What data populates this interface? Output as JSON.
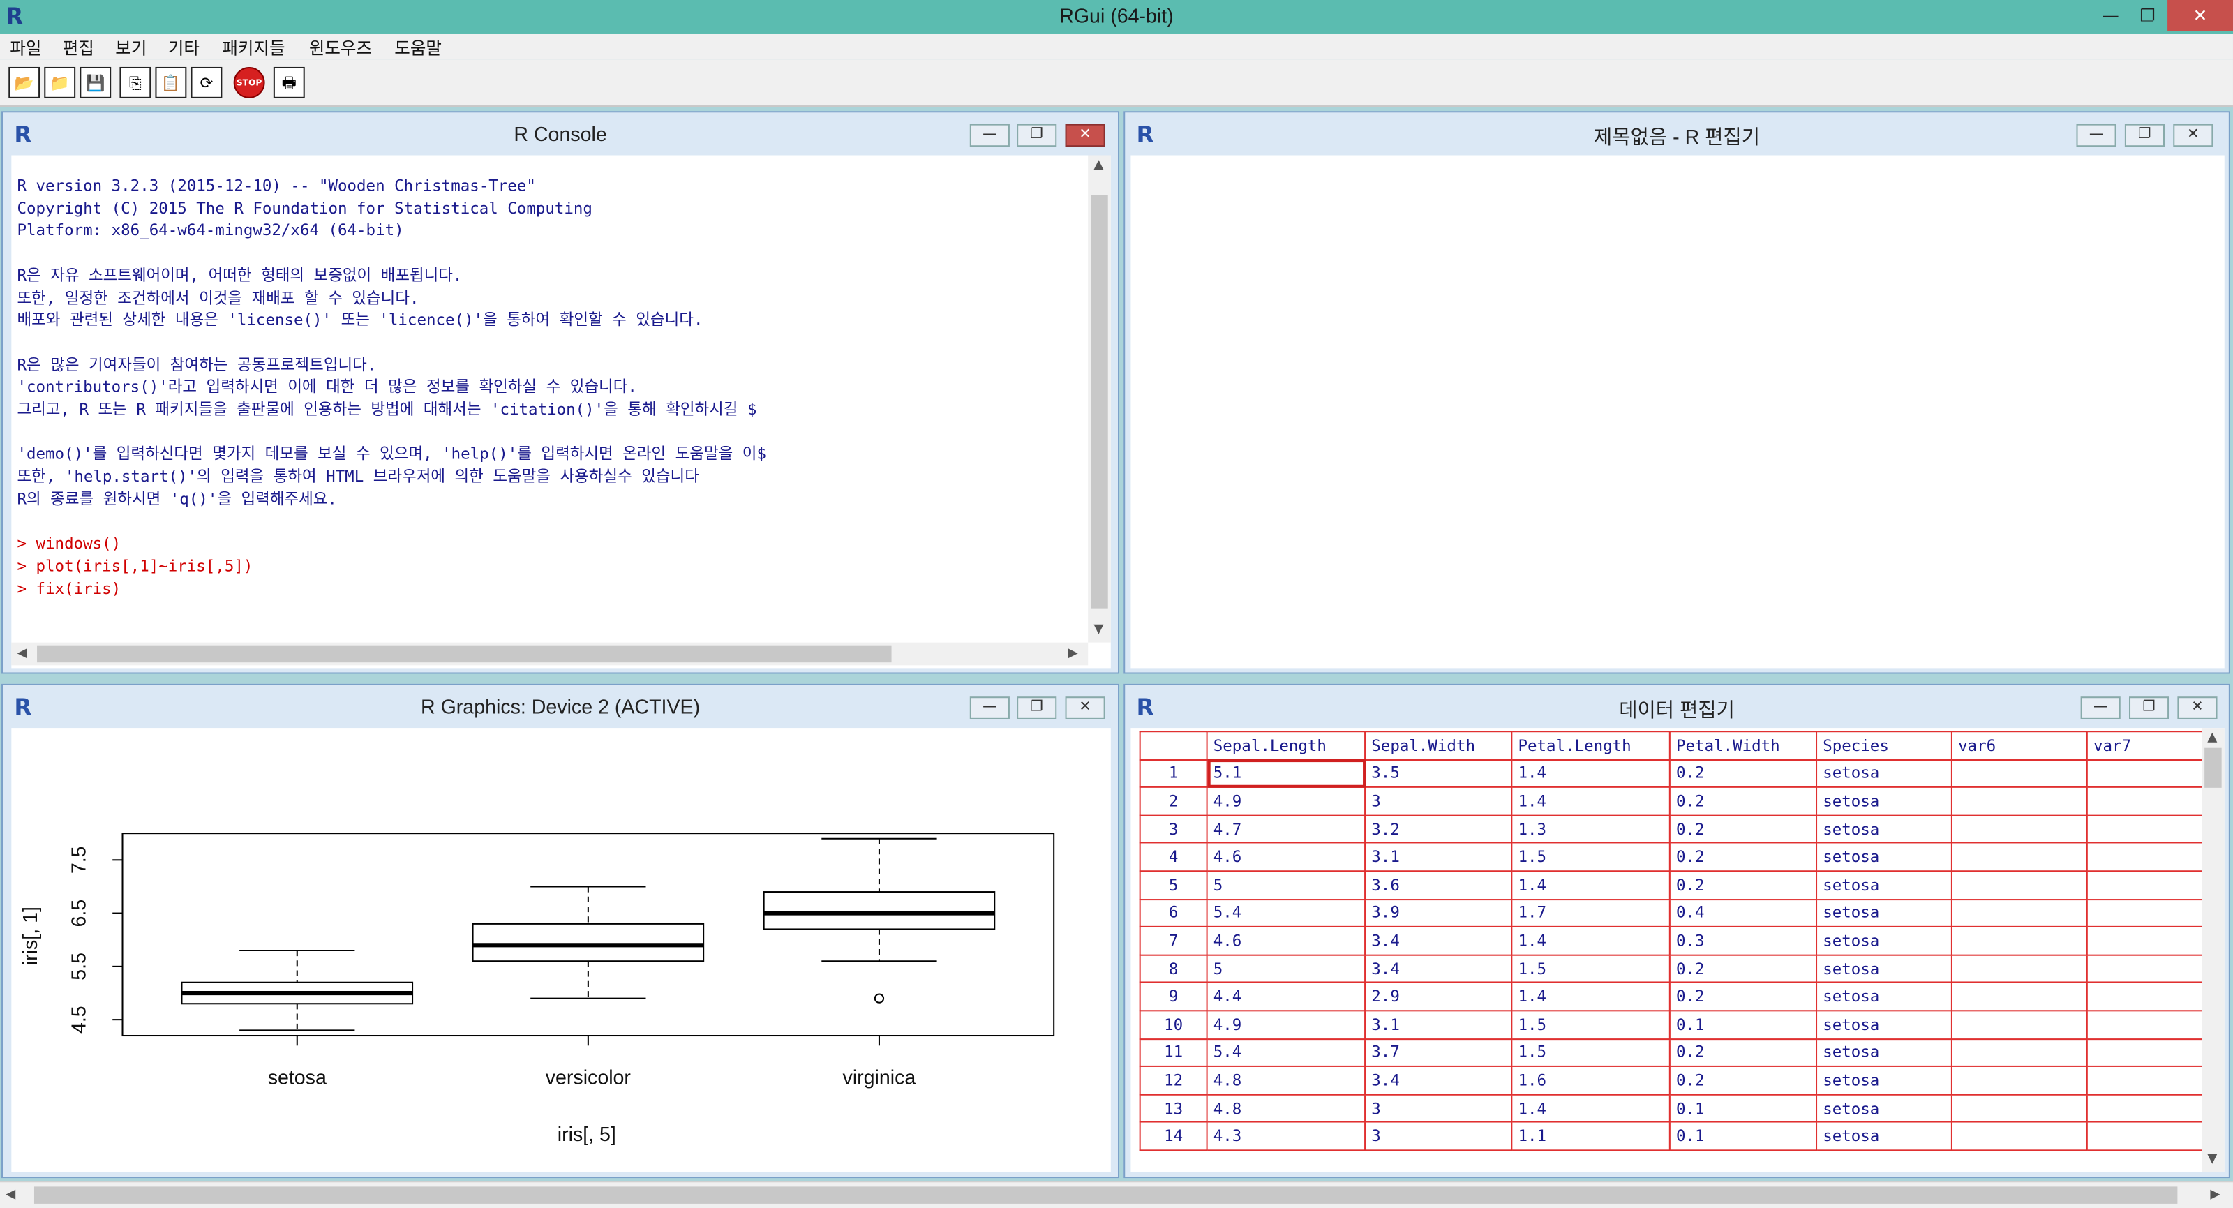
{
  "app": {
    "title": "RGui (64-bit)",
    "logo": "R"
  },
  "window_controls": {
    "minimize": "—",
    "restore": "❐",
    "close": "✕"
  },
  "menu": [
    "파일",
    "편집",
    "보기",
    "기타",
    "패키지들",
    "윈도우즈",
    "도움말"
  ],
  "toolbar": [
    {
      "name": "open-script-icon",
      "glyph": "📂"
    },
    {
      "name": "load-workspace-icon",
      "glyph": "📁"
    },
    {
      "name": "save-icon",
      "glyph": "💾"
    },
    {
      "name": "copy-icon",
      "glyph": "⎘"
    },
    {
      "name": "paste-icon",
      "glyph": "📋"
    },
    {
      "name": "refresh-icon",
      "glyph": "⟳"
    },
    {
      "name": "stop-icon",
      "glyph": "STOP"
    },
    {
      "name": "print-icon",
      "glyph": "🖶"
    }
  ],
  "console": {
    "title": "R Console",
    "lines": [
      "R version 3.2.3 (2015-12-10) -- \"Wooden Christmas-Tree\"",
      "Copyright (C) 2015 The R Foundation for Statistical Computing",
      "Platform: x86_64-w64-mingw32/x64 (64-bit)",
      "",
      "R은 자유 소프트웨어이며, 어떠한 형태의 보증없이 배포됩니다.",
      "또한, 일정한 조건하에서 이것을 재배포 할 수 있습니다.",
      "배포와 관련된 상세한 내용은 'license()' 또는 'licence()'을 통하여 확인할 수 있습니다.",
      "",
      "R은 많은 기여자들이 참여하는 공동프로젝트입니다.",
      "'contributors()'라고 입력하시면 이에 대한 더 많은 정보를 확인하실 수 있습니다.",
      "그리고, R 또는 R 패키지들을 출판물에 인용하는 방법에 대해서는 'citation()'을 통해 확인하시길 $",
      "",
      "'demo()'를 입력하신다면 몇가지 데모를 보실 수 있으며, 'help()'를 입력하시면 온라인 도움말을 이$",
      "또한, 'help.start()'의 입력을 통하여 HTML 브라우저에 의한 도움말을 사용하실수 있습니다",
      "R의 종료를 원하시면 'q()'을 입력해주세요.",
      ""
    ],
    "commands": [
      "> windows()",
      "> plot(iris[,1]~iris[,5])",
      "> fix(iris)"
    ]
  },
  "editor": {
    "title": "제목없음 - R 편집기"
  },
  "graphics": {
    "title": "R Graphics: Device 2 (ACTIVE)"
  },
  "chart_data": {
    "type": "boxplot",
    "title": "",
    "xlabel": "iris[, 5]",
    "ylabel": "iris[, 1]",
    "categories": [
      "setosa",
      "versicolor",
      "virginica"
    ],
    "yticks": [
      "4.5",
      "5.5",
      "6.5",
      "7.5"
    ],
    "ylim": [
      4.2,
      8.0
    ],
    "boxes": [
      {
        "name": "setosa",
        "min": 4.3,
        "q1": 4.8,
        "median": 5.0,
        "q3": 5.2,
        "max": 5.8,
        "outliers": []
      },
      {
        "name": "versicolor",
        "min": 4.9,
        "q1": 5.6,
        "median": 5.9,
        "q3": 6.3,
        "max": 7.0,
        "outliers": []
      },
      {
        "name": "virginica",
        "min": 5.6,
        "q1": 6.2,
        "median": 6.5,
        "q3": 6.9,
        "max": 7.9,
        "outliers": [
          4.9
        ]
      }
    ]
  },
  "data_editor": {
    "title": "데이터 편집기",
    "columns": [
      "Sepal.Length",
      "Sepal.Width",
      "Petal.Length",
      "Petal.Width",
      "Species",
      "var6",
      "var7"
    ],
    "rows": [
      [
        "1",
        "5.1",
        "3.5",
        "1.4",
        "0.2",
        "setosa",
        "",
        ""
      ],
      [
        "2",
        "4.9",
        "3",
        "1.4",
        "0.2",
        "setosa",
        "",
        ""
      ],
      [
        "3",
        "4.7",
        "3.2",
        "1.3",
        "0.2",
        "setosa",
        "",
        ""
      ],
      [
        "4",
        "4.6",
        "3.1",
        "1.5",
        "0.2",
        "setosa",
        "",
        ""
      ],
      [
        "5",
        "5",
        "3.6",
        "1.4",
        "0.2",
        "setosa",
        "",
        ""
      ],
      [
        "6",
        "5.4",
        "3.9",
        "1.7",
        "0.4",
        "setosa",
        "",
        ""
      ],
      [
        "7",
        "4.6",
        "3.4",
        "1.4",
        "0.3",
        "setosa",
        "",
        ""
      ],
      [
        "8",
        "5",
        "3.4",
        "1.5",
        "0.2",
        "setosa",
        "",
        ""
      ],
      [
        "9",
        "4.4",
        "2.9",
        "1.4",
        "0.2",
        "setosa",
        "",
        ""
      ],
      [
        "10",
        "4.9",
        "3.1",
        "1.5",
        "0.1",
        "setosa",
        "",
        ""
      ],
      [
        "11",
        "5.4",
        "3.7",
        "1.5",
        "0.2",
        "setosa",
        "",
        ""
      ],
      [
        "12",
        "4.8",
        "3.4",
        "1.6",
        "0.2",
        "setosa",
        "",
        ""
      ],
      [
        "13",
        "4.8",
        "3",
        "1.4",
        "0.1",
        "setosa",
        "",
        ""
      ],
      [
        "14",
        "4.3",
        "3",
        "1.1",
        "0.1",
        "setosa",
        "",
        ""
      ]
    ]
  }
}
